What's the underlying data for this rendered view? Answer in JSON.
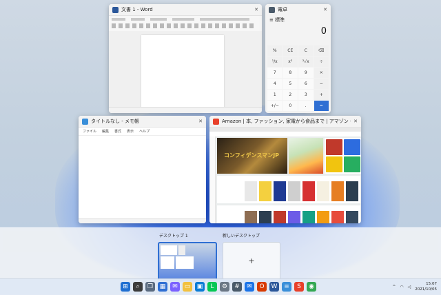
{
  "windows": {
    "word": {
      "title": "文書 1 - Word"
    },
    "calculator": {
      "title": "電卓",
      "mode": "標準",
      "display": "0",
      "keys": [
        "%",
        "CE",
        "C",
        "⌫",
        "¹/x",
        "x²",
        "²√x",
        "÷",
        "7",
        "8",
        "9",
        "×",
        "4",
        "5",
        "6",
        "−",
        "1",
        "2",
        "3",
        "+",
        "+/−",
        "0",
        ".",
        "="
      ]
    },
    "notepad": {
      "title": "タイトルなし - メモ帳",
      "menu": [
        "ファイル",
        "編集",
        "書式",
        "表示",
        "ヘルプ"
      ]
    },
    "browser": {
      "title": "Amazon | 本, ファッション, 家電から食品まで | アマゾン - Sidekick",
      "hero_text": "コンフィデンスマンJP"
    }
  },
  "desktops": {
    "desktop1": {
      "label": "デスクトップ 1"
    },
    "new_desktop": {
      "label": "新しいデスクトップ",
      "plus": "+"
    }
  },
  "taskbar": {
    "apps": [
      "start-icon",
      "search-icon",
      "taskview-icon",
      "widgets-icon",
      "chat-icon",
      "explorer-icon",
      "store-icon",
      "line-icon",
      "settings-icon",
      "calculator-icon",
      "mail-icon",
      "office-icon",
      "word-icon",
      "notepad-icon",
      "sidekick-icon",
      "chrome-icon"
    ],
    "clock_time": "15:07",
    "clock_date": "2021/10/05"
  },
  "colors": {
    "accent": "#2f6fd3",
    "word_blue": "#2b579a"
  }
}
